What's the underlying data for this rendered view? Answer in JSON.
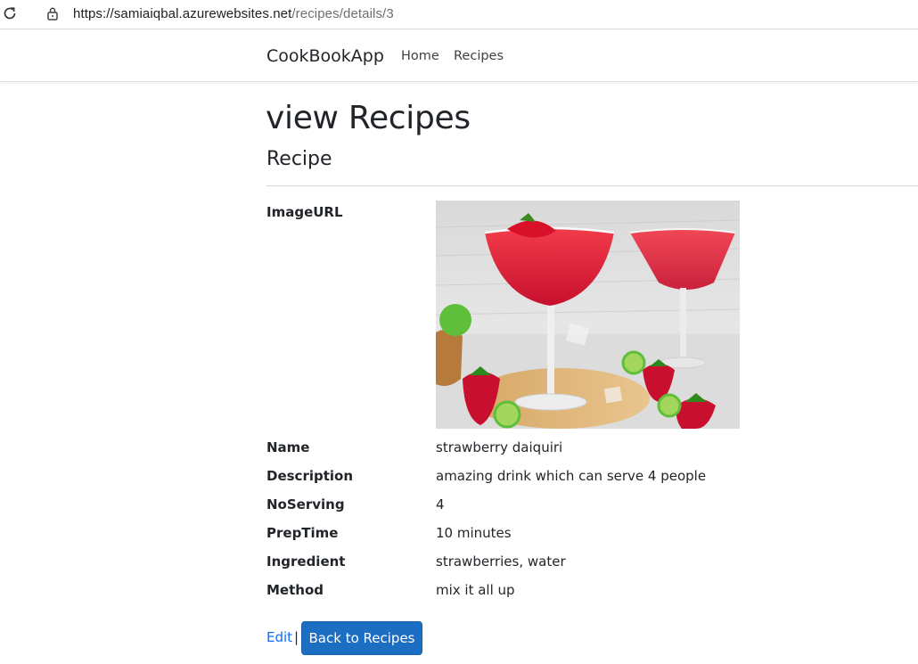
{
  "browser": {
    "url_host": "https://samiaiqbal.azurewebsites.net",
    "url_path": "/recipes/details/3",
    "icons": {
      "reload": "reload-icon",
      "lock": "lock-icon"
    }
  },
  "navbar": {
    "brand": "CookBookApp",
    "links": [
      "Home",
      "Recipes"
    ]
  },
  "page": {
    "title": "view Recipes",
    "subtitle": "Recipe"
  },
  "details": {
    "image_label": "ImageURL",
    "image": "strawberry daiquiri cocktails in margarita glasses with strawberries and limes",
    "fields": [
      {
        "label": "Name",
        "value": "strawberry daiquiri"
      },
      {
        "label": "Description",
        "value": "amazing drink which can serve 4 people"
      },
      {
        "label": "NoServing",
        "value": "4"
      },
      {
        "label": "PrepTime",
        "value": "10 minutes"
      },
      {
        "label": "Ingredient",
        "value": "strawberries, water"
      },
      {
        "label": "Method",
        "value": "mix it all up"
      }
    ]
  },
  "actions": {
    "edit": "Edit",
    "separator": "|",
    "back": "Back to Recipes"
  },
  "colors": {
    "link": "#0d6efd",
    "button": "#1b6ec2",
    "text": "#212529"
  }
}
